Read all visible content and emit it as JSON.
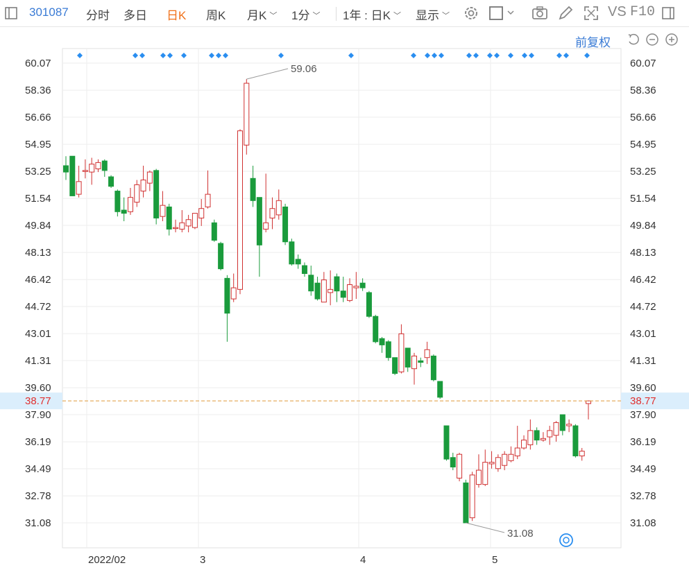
{
  "toolbar": {
    "code": "301087",
    "items": [
      "分时",
      "多日",
      "日K",
      "周K",
      "月K",
      "1分",
      "1年 : 日K",
      "显示"
    ],
    "vs": "VS",
    "f10": "F10"
  },
  "chart_header": {
    "restore": "前复权"
  },
  "price_axis": [
    "60.07",
    "58.36",
    "56.66",
    "54.95",
    "53.25",
    "51.54",
    "49.84",
    "48.13",
    "46.42",
    "44.72",
    "43.01",
    "41.31",
    "39.60",
    "37.90",
    "36.19",
    "34.49",
    "32.78",
    "31.08"
  ],
  "current_price": "38.77",
  "colors": {
    "up": "#d03030",
    "down": "#1a9b3c",
    "accent": "#3a7bd5",
    "active_tab": "#f07018"
  },
  "chart_data": {
    "type": "candlestick",
    "x_labels": [
      "2022/02",
      "3",
      "4",
      "5"
    ],
    "ylim": [
      31.08,
      60.07
    ],
    "high_label": "59.06",
    "low_label": "31.08",
    "last_close": 38.77,
    "candles": [
      [
        53.6,
        53.2,
        54.2,
        52.7
      ],
      [
        54.2,
        51.7,
        54.2,
        51.7
      ],
      [
        51.8,
        52.6,
        53.6,
        51.6
      ],
      [
        53.3,
        53.3,
        54.0,
        52.8
      ],
      [
        53.2,
        53.7,
        54.1,
        52.4
      ],
      [
        53.4,
        53.8,
        54.0,
        53.2
      ],
      [
        53.9,
        53.3,
        54.0,
        52.9
      ],
      [
        52.9,
        52.3,
        53.0,
        52.2
      ],
      [
        52.0,
        50.7,
        52.1,
        50.4
      ],
      [
        50.8,
        50.6,
        51.6,
        50.1
      ],
      [
        50.7,
        51.6,
        52.2,
        50.5
      ],
      [
        51.3,
        52.4,
        52.7,
        51.0
      ],
      [
        52.0,
        52.7,
        53.6,
        51.6
      ],
      [
        52.5,
        53.2,
        53.3,
        52.0
      ],
      [
        53.3,
        50.3,
        53.4,
        49.9
      ],
      [
        50.4,
        51.1,
        52.0,
        50.1
      ],
      [
        51.0,
        49.6,
        51.2,
        49.2
      ],
      [
        49.7,
        49.7,
        50.2,
        49.4
      ],
      [
        49.6,
        50.0,
        50.8,
        49.4
      ],
      [
        49.8,
        50.2,
        50.5,
        49.4
      ],
      [
        49.7,
        50.6,
        50.6,
        49.6
      ],
      [
        50.3,
        50.9,
        51.5,
        49.8
      ],
      [
        51.0,
        51.8,
        53.3,
        50.9
      ],
      [
        50.0,
        48.9,
        50.2,
        48.8
      ],
      [
        48.7,
        47.1,
        48.8,
        47.0
      ],
      [
        46.5,
        44.3,
        46.7,
        42.5
      ],
      [
        45.2,
        45.9,
        46.8,
        45.0
      ],
      [
        45.8,
        55.8,
        55.9,
        45.5
      ],
      [
        54.9,
        58.8,
        59.06,
        54.3
      ],
      [
        52.8,
        51.4,
        53.6,
        51.0
      ],
      [
        51.6,
        48.6,
        51.6,
        46.6
      ],
      [
        49.6,
        50.0,
        53.1,
        49.4
      ],
      [
        50.3,
        50.9,
        51.6,
        49.6
      ],
      [
        50.5,
        51.4,
        52.1,
        50.2
      ],
      [
        51.0,
        48.8,
        51.2,
        48.6
      ],
      [
        48.8,
        47.4,
        49.0,
        47.3
      ],
      [
        47.7,
        47.4,
        48.0,
        47.1
      ],
      [
        47.3,
        46.8,
        47.5,
        46.6
      ],
      [
        46.7,
        45.7,
        47.3,
        45.4
      ],
      [
        46.2,
        45.2,
        46.6,
        45.1
      ],
      [
        45.0,
        46.4,
        46.9,
        45.0
      ],
      [
        45.6,
        45.8,
        47.0,
        44.8
      ],
      [
        46.6,
        45.7,
        46.8,
        45.0
      ],
      [
        45.7,
        45.3,
        46.6,
        45.0
      ],
      [
        45.1,
        46.1,
        46.5,
        45.0
      ],
      [
        45.9,
        46.0,
        46.9,
        45.2
      ],
      [
        46.2,
        45.9,
        46.5,
        45.7
      ],
      [
        45.6,
        44.1,
        45.7,
        44.0
      ],
      [
        44.1,
        42.5,
        44.2,
        42.4
      ],
      [
        42.7,
        42.3,
        42.8,
        41.8
      ],
      [
        42.5,
        41.5,
        42.6,
        41.3
      ],
      [
        41.5,
        40.5,
        41.5,
        40.4
      ],
      [
        40.6,
        43.0,
        43.6,
        40.5
      ],
      [
        42.1,
        40.9,
        42.1,
        40.6
      ],
      [
        40.8,
        41.6,
        41.8,
        39.8
      ],
      [
        41.3,
        41.2,
        41.5,
        40.9
      ],
      [
        41.5,
        42.0,
        42.5,
        41.1
      ],
      [
        41.6,
        40.1,
        41.7,
        40.0
      ],
      [
        40.0,
        39.0,
        40.0,
        38.9
      ],
      [
        37.2,
        35.1,
        37.2,
        35.0
      ],
      [
        35.2,
        34.6,
        35.5,
        34.4
      ],
      [
        33.9,
        35.4,
        35.5,
        33.7
      ],
      [
        33.6,
        31.08,
        33.8,
        31.08
      ],
      [
        31.4,
        34.1,
        34.3,
        31.2
      ],
      [
        33.5,
        34.4,
        35.4,
        33.3
      ],
      [
        33.5,
        34.9,
        35.7,
        33.4
      ],
      [
        34.8,
        34.9,
        35.6,
        34.5
      ],
      [
        34.5,
        35.2,
        35.4,
        34.3
      ],
      [
        34.7,
        35.4,
        35.6,
        34.4
      ],
      [
        35.0,
        35.4,
        35.9,
        34.9
      ],
      [
        35.3,
        35.8,
        37.2,
        35.1
      ],
      [
        35.8,
        36.3,
        36.6,
        35.7
      ],
      [
        36.0,
        36.9,
        37.6,
        35.7
      ],
      [
        36.9,
        36.3,
        37.1,
        36.0
      ],
      [
        36.3,
        36.4,
        36.8,
        36.2
      ],
      [
        36.5,
        36.9,
        37.2,
        36.0
      ],
      [
        36.6,
        37.4,
        37.5,
        36.2
      ],
      [
        37.9,
        36.9,
        37.9,
        36.6
      ],
      [
        37.2,
        37.3,
        37.6,
        36.8
      ],
      [
        37.2,
        35.3,
        37.3,
        35.2
      ],
      [
        35.3,
        35.6,
        35.8,
        35.0
      ],
      [
        38.6,
        38.77,
        38.8,
        37.6
      ]
    ]
  }
}
